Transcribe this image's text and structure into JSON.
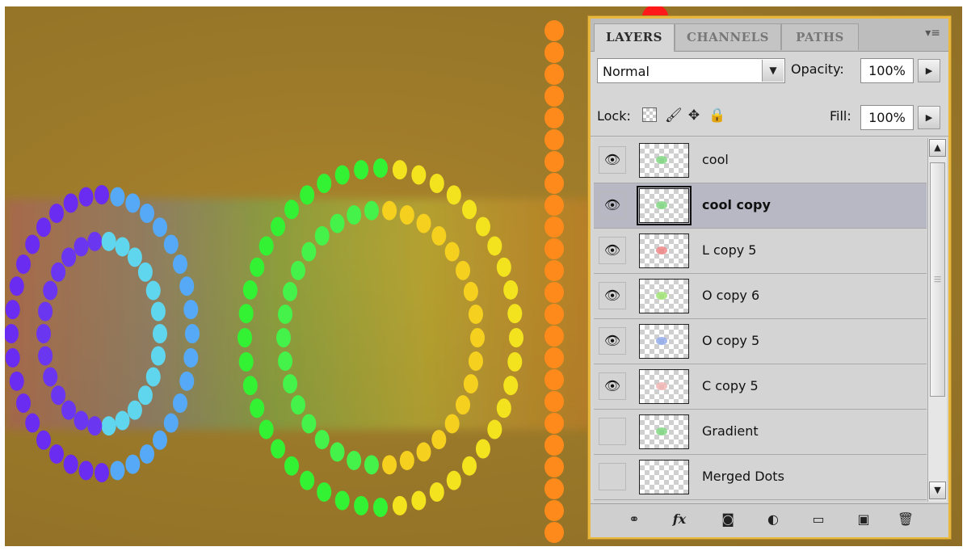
{
  "panel": {
    "tabs": [
      {
        "label": "LAYERS",
        "active": true
      },
      {
        "label": "CHANNELS",
        "active": false
      },
      {
        "label": "PATHS",
        "active": false
      }
    ],
    "menu_icon": "panel-menu-icon",
    "blend_mode": "Normal",
    "opacity_label": "Opacity:",
    "opacity_value": "100%",
    "lock_label": "Lock:",
    "fill_label": "Fill:",
    "fill_value": "100%",
    "layers": [
      {
        "name": "cool",
        "visible": true,
        "selected": false
      },
      {
        "name": "cool copy",
        "visible": true,
        "selected": true
      },
      {
        "name": "L copy 5",
        "visible": true,
        "selected": false
      },
      {
        "name": "O copy 6",
        "visible": true,
        "selected": false
      },
      {
        "name": "O copy 5",
        "visible": true,
        "selected": false
      },
      {
        "name": "C copy 5",
        "visible": true,
        "selected": false
      },
      {
        "name": "Gradient",
        "visible": false,
        "selected": false
      },
      {
        "name": "Merged Dots",
        "visible": false,
        "selected": false
      }
    ],
    "footer_icons": [
      "link-layers-icon",
      "layer-style-fx-icon",
      "add-mask-icon",
      "adjustment-layer-icon",
      "new-group-icon",
      "new-layer-icon",
      "delete-layer-icon"
    ]
  },
  "colors": {
    "canvas_bg": "#9c7a2a",
    "panel_border": "#e9b73c",
    "selected_row": "#b8b8c4"
  }
}
